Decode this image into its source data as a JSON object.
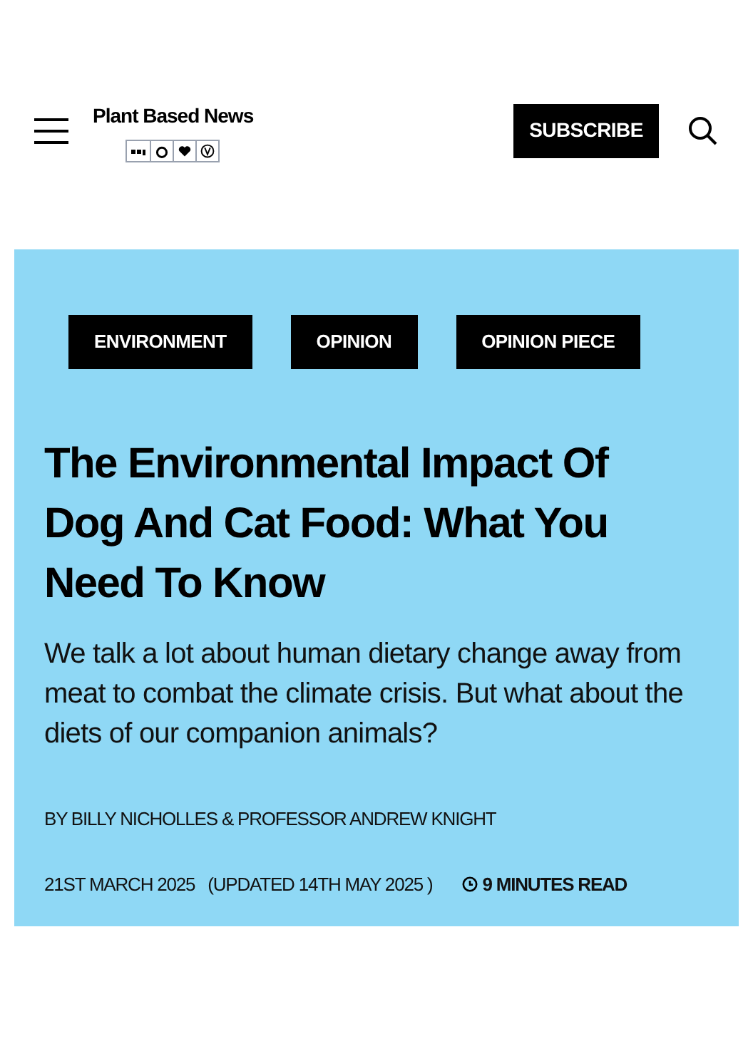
{
  "header": {
    "brand": "Plant Based News",
    "subscribe": "SUBSCRIBE"
  },
  "article": {
    "tags": [
      "ENVIRONMENT",
      "OPINION",
      "OPINION PIECE"
    ],
    "title": "The Environmental Impact Of Dog And Cat Food: What You Need To Know",
    "standfirst": "We talk a lot about human dietary change away from meat to combat the climate crisis. But what about the diets of our companion animals?",
    "byline": "BY BILLY NICHOLLES & PROFESSOR ANDREW KNIGHT",
    "date": "21ST MARCH 2025",
    "updated": "(UPDATED 14TH MAY 2025 )",
    "read_time": "9 MINUTES READ"
  }
}
